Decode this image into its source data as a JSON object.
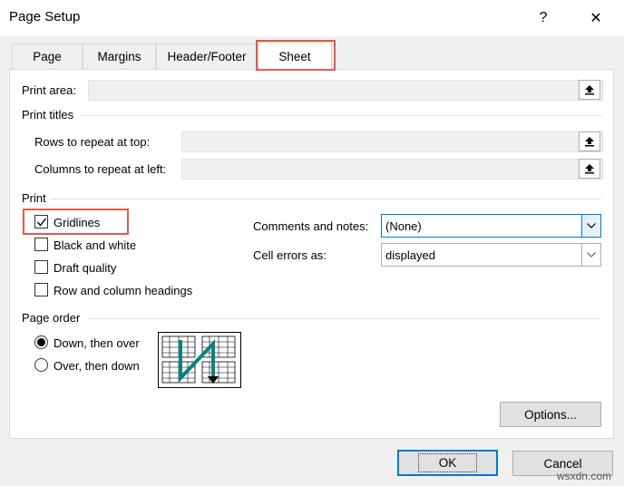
{
  "dialog": {
    "title": "Page Setup",
    "help_label": "?",
    "close_label": "✕"
  },
  "tabs": [
    {
      "label": "Page",
      "active": false
    },
    {
      "label": "Margins",
      "active": false
    },
    {
      "label": "Header/Footer",
      "active": false
    },
    {
      "label": "Sheet",
      "active": true
    }
  ],
  "print_area": {
    "label": "Print area:",
    "value": ""
  },
  "print_titles": {
    "heading": "Print titles",
    "rows_label": "Rows to repeat at top:",
    "rows_value": "",
    "cols_label": "Columns to repeat at left:",
    "cols_value": ""
  },
  "print": {
    "heading": "Print",
    "gridlines": {
      "label": "Gridlines",
      "checked": true
    },
    "black_white": {
      "label": "Black and white",
      "checked": false
    },
    "draft": {
      "label": "Draft quality",
      "checked": false
    },
    "headings": {
      "label": "Row and column headings",
      "checked": false
    },
    "comments_label": "Comments and notes:",
    "comments_value": "(None)",
    "errors_label": "Cell errors as:",
    "errors_value": "displayed"
  },
  "page_order": {
    "heading": "Page order",
    "down_over": {
      "label": "Down, then over",
      "selected": true
    },
    "over_down": {
      "label": "Over, then down",
      "selected": false
    }
  },
  "buttons": {
    "options": "Options...",
    "ok": "OK",
    "cancel": "Cancel"
  },
  "watermark": "wsxdn.com",
  "colors": {
    "highlight": "#e05b4b",
    "accent": "#0078d7",
    "arrow": "#0e8080"
  }
}
